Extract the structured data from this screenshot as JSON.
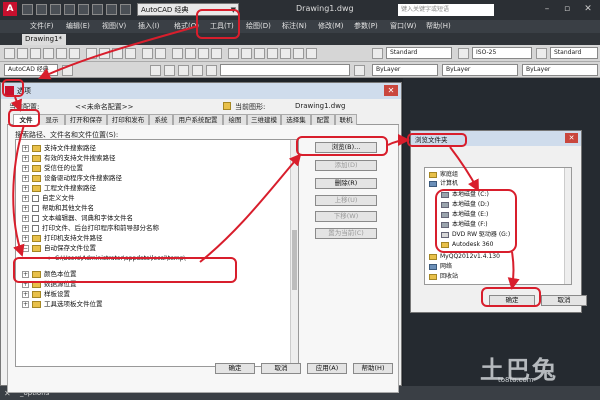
{
  "app": {
    "workspace": "AutoCAD 经典",
    "document_title": "Drawing1.dwg",
    "search_placeholder": "键入关键字或短语"
  },
  "menu": [
    "文件(F)",
    "编辑(E)",
    "视图(V)",
    "插入(I)",
    "格式(O)",
    "工具(T)",
    "绘图(D)",
    "标注(N)",
    "修改(M)",
    "参数(P)",
    "窗口(W)",
    "帮助(H)"
  ],
  "doc_tab": "Drawing1*",
  "toolbar": {
    "layer_combo": "AutoCAD 经典",
    "text_style": "Standard",
    "dim_style": "ISO-25",
    "table_style": "Standard",
    "color": "ByLayer",
    "linetype": "ByLayer",
    "lineweight": "ByLayer"
  },
  "options_dialog": {
    "title": "选项",
    "profile_label": "当前配置:",
    "profile_value": "<<未命名配置>>",
    "drawing_label": "当前图形:",
    "drawing_value": "Drawing1.dwg",
    "tabs": [
      "文件",
      "显示",
      "打开和保存",
      "打印和发布",
      "系统",
      "用户系统配置",
      "绘图",
      "三维建模",
      "选择集",
      "配置",
      "联机"
    ],
    "search_path_label": "搜索路径、文件名和文件位置(S):",
    "tree": [
      {
        "label": "支持文件搜索路径",
        "icon": "folder"
      },
      {
        "label": "有效的支持文件搜索路径",
        "icon": "folder"
      },
      {
        "label": "受信任的位置",
        "icon": "folder"
      },
      {
        "label": "设备驱动程序文件搜索路径",
        "icon": "folder"
      },
      {
        "label": "工程文件搜索路径",
        "icon": "folder"
      },
      {
        "label": "自定义文件",
        "icon": "doc"
      },
      {
        "label": "帮助和其他文件名",
        "icon": "doc"
      },
      {
        "label": "文本编辑器、词典和字体文件名",
        "icon": "doc"
      },
      {
        "label": "打印文件、后台打印程序和前导部分名称",
        "icon": "doc"
      },
      {
        "label": "打印机支持文件路径",
        "icon": "folder"
      },
      {
        "label": "自动保存文件位置",
        "icon": "folder"
      }
    ],
    "autosave_path": "C:\\Users\\Administrator\\appdata\\local\\temp\\",
    "tree_after": [
      {
        "label": "颜色本位置",
        "icon": "folder"
      },
      {
        "label": "数据源位置",
        "icon": "folder"
      },
      {
        "label": "样板设置",
        "icon": "folder"
      },
      {
        "label": "工具选项板文件位置",
        "icon": "folder"
      }
    ],
    "side_buttons": [
      "浏览(B)...",
      "添加(D)",
      "删除(R)",
      "上移(U)",
      "下移(W)",
      "置为当前(C)"
    ],
    "bottom_buttons": [
      "确定",
      "取消",
      "应用(A)",
      "帮助(H)"
    ]
  },
  "browse_dialog": {
    "title": "浏览文件夹",
    "items": [
      {
        "label": "家庭组",
        "icon": "folder",
        "indent": 0
      },
      {
        "label": "计算机",
        "icon": "pc",
        "indent": 0
      },
      {
        "label": "本地磁盘 (C:)",
        "icon": "disk",
        "indent": 1
      },
      {
        "label": "本地磁盘 (D:)",
        "icon": "disk",
        "indent": 1
      },
      {
        "label": "本地磁盘 (E:)",
        "icon": "disk",
        "indent": 1
      },
      {
        "label": "本地磁盘 (F:)",
        "icon": "disk",
        "indent": 1
      },
      {
        "label": "DVD RW 驱动器 (G:)",
        "icon": "dvd",
        "indent": 1
      },
      {
        "label": "Autodesk 360",
        "icon": "folder",
        "indent": 1
      },
      {
        "label": "MyQQ2012v1.4.130",
        "icon": "folder",
        "indent": 0
      },
      {
        "label": "网络",
        "icon": "pc",
        "indent": 0
      },
      {
        "label": "回收站",
        "icon": "folder",
        "indent": 0
      }
    ],
    "ok": "确定",
    "cancel": "取消"
  },
  "command_line": "_options",
  "watermark": {
    "text": "土巴兔",
    "sub": "to8to.com"
  },
  "colors": {
    "annotation": "#d81e2c",
    "dialog_title": "#cfdcec"
  }
}
